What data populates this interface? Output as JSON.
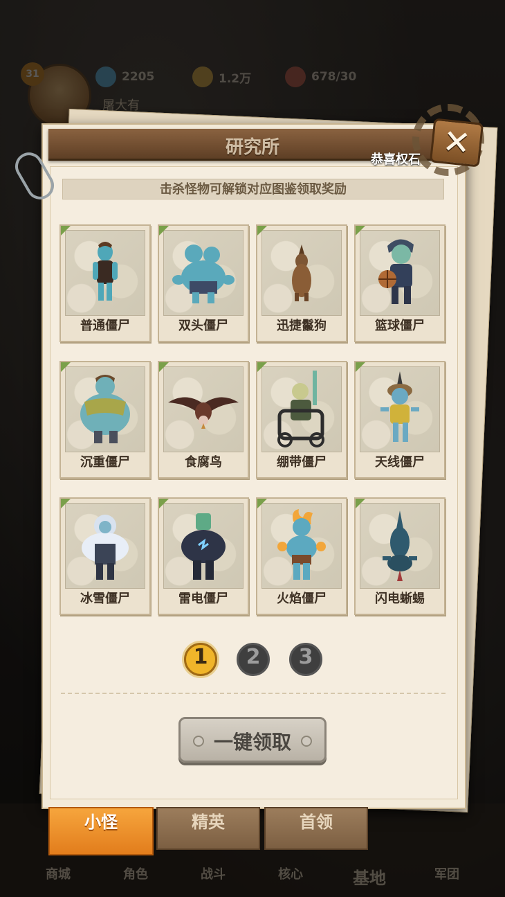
{
  "hud": {
    "level": "31",
    "player_name": "屠大有",
    "gems": "2205",
    "gold": "1.2万",
    "stamina": "678/30"
  },
  "bottom_nav": [
    "商城",
    "角色",
    "战斗",
    "核心",
    "基地",
    "军团"
  ],
  "panel": {
    "title": "研究所",
    "congrats_tag": "恭喜权石",
    "close_icon": "✕",
    "hint": "击杀怪物可解锁对应图鉴领取奖励"
  },
  "cards": [
    {
      "name": "普通僵尸",
      "icon": "zombie-common-icon"
    },
    {
      "name": "双头僵尸",
      "icon": "zombie-two-headed-icon"
    },
    {
      "name": "迅捷鬣狗",
      "icon": "hyena-icon"
    },
    {
      "name": "篮球僵尸",
      "icon": "zombie-basketball-icon"
    },
    {
      "name": "沉重僵尸",
      "icon": "zombie-heavy-icon"
    },
    {
      "name": "食腐鸟",
      "icon": "vulture-icon"
    },
    {
      "name": "绷带僵尸",
      "icon": "zombie-bandage-icon"
    },
    {
      "name": "天线僵尸",
      "icon": "zombie-antenna-icon"
    },
    {
      "name": "冰雪僵尸",
      "icon": "zombie-ice-icon"
    },
    {
      "name": "雷电僵尸",
      "icon": "zombie-thunder-icon"
    },
    {
      "name": "火焰僵尸",
      "icon": "zombie-fire-icon"
    },
    {
      "name": "闪电蜥蜴",
      "icon": "lizard-lightning-icon"
    }
  ],
  "pagination": {
    "pages": [
      "1",
      "2",
      "3"
    ],
    "current": "1"
  },
  "claim_all_label": "一键领取",
  "tabs": {
    "minion": "小怪",
    "elite": "精英",
    "boss": "首领"
  },
  "colors": {
    "accent": "#f0b52a",
    "tab_active": "#e27d1c",
    "panel": "#f3ead9"
  }
}
